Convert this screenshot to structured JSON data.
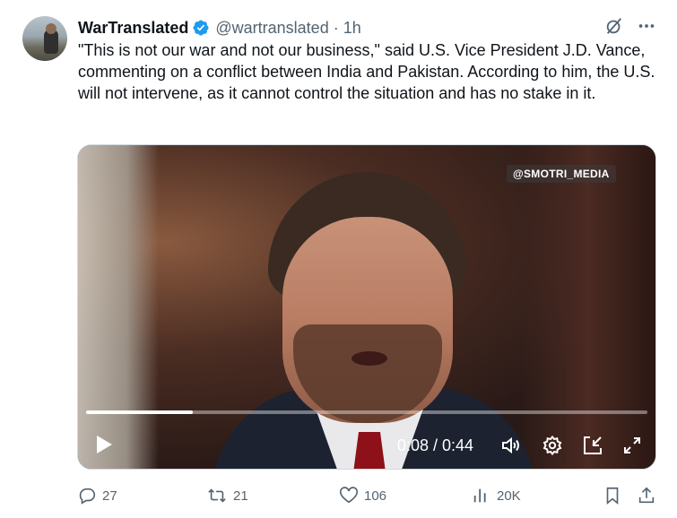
{
  "tweet": {
    "author_name": "WarTranslated",
    "handle": "@wartranslated",
    "separator": "·",
    "time": "1h",
    "text": "\"This is not our war and not our business,\" said U.S. Vice President J.D. Vance, commenting on a conflict between India and Pakistan. According to him, the U.S. will not intervene, as it cannot control the situation and has no stake in it.",
    "verified_color": "#1d9bf0",
    "top_icons": [
      "grok-slash-icon",
      "more-icon"
    ]
  },
  "video": {
    "watermark": "@SMOTRI_MEDIA",
    "timecode": "0:08 / 0:44",
    "progress_fraction": 0.19,
    "controls": [
      "play-icon",
      "volume-icon",
      "settings-icon",
      "pip-icon",
      "fullscreen-icon"
    ]
  },
  "actions": {
    "replies": "27",
    "reposts": "21",
    "likes": "106",
    "views": "20K",
    "icons": [
      "reply-icon",
      "repost-icon",
      "like-icon",
      "views-icon",
      "bookmark-icon",
      "share-icon"
    ]
  }
}
